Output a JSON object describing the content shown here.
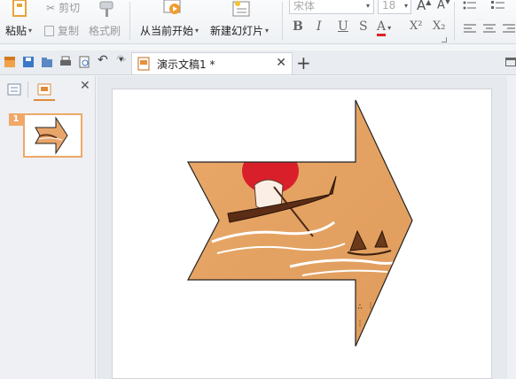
{
  "ribbon": {
    "paste_label": "粘贴",
    "cut_label": "剪切",
    "copy_label": "复制",
    "format_painter_label": "格式刷",
    "from_current_label": "从当前开始",
    "new_slide_label": "新建幻灯片",
    "font_name": "宋体",
    "font_size": "18",
    "bold": "B",
    "italic": "I",
    "underline": "U",
    "strike": "S",
    "font_color": "A",
    "superscript": "X²",
    "subscript": "X₂"
  },
  "tabs": {
    "document_title": "演示文稿1 *"
  },
  "slides_panel": {
    "slide_number": "1"
  },
  "colors": {
    "accent": "#f0a868",
    "arrow_fill": "#e8a56a",
    "arrow_outline": "#222222"
  },
  "icons": [
    "paste-icon",
    "cut-icon",
    "copy-icon",
    "format-painter-icon",
    "slideshow-icon",
    "new-slide-icon",
    "font-size-up-icon",
    "font-size-down-icon",
    "save-icon",
    "print-icon",
    "undo-icon",
    "redo-icon",
    "outline-icon",
    "slides-icon",
    "close-icon"
  ]
}
